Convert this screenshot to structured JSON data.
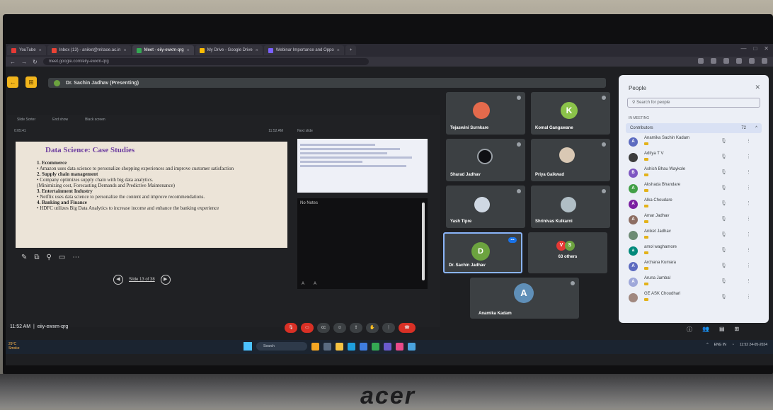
{
  "browser": {
    "tabs": [
      {
        "label": "YouTube",
        "color": "#e53935",
        "active": false
      },
      {
        "label": "Inbox (13) - aniket@mitaoe.ac.in",
        "color": "#ea4335",
        "active": false
      },
      {
        "label": "Meet - eiiy-ewxm-qrg",
        "color": "#34a853",
        "active": true
      },
      {
        "label": "My Drive - Google Drive",
        "color": "#fbbc04",
        "active": false
      },
      {
        "label": "Webinar Importance and Oppo",
        "color": "#7b61ff",
        "active": false
      }
    ],
    "url": "meet.google.com/eiiy-ewxm-qrg"
  },
  "meet": {
    "presenting_label": "Dr. Sachin Jadhav (Presenting)",
    "presentation": {
      "top_tabs": [
        "Slide Sorter",
        "End show",
        "Black screen"
      ],
      "timer_left": "0:05:41",
      "timer_right": "11:52 AM",
      "next_slide_label": "Next slide",
      "notes_label": "No Notes",
      "slide_counter": "Slide 13 of 38",
      "slide": {
        "title": "Data Science:  Case Studies",
        "lines": [
          {
            "text": "1. Ecommerce",
            "heading": true
          },
          {
            "text": "• Amazon uses data science to personalize shopping experiences and improve customer satisfaction",
            "heading": false
          },
          {
            "text": "2. Supply chain management",
            "heading": true
          },
          {
            "text": "• Company optimizes supply chain with big data analytics.",
            "heading": false
          },
          {
            "text": "  (Minimizing cost, Forecasting Demands and Predictive Maintenance)",
            "heading": false
          },
          {
            "text": "3. Entertainment Industry",
            "heading": true
          },
          {
            "text": "• Netflix uses data science to personalize the content and improve recommendations.",
            "heading": false
          },
          {
            "text": "4. Banking and Finance",
            "heading": true
          },
          {
            "text": "• HDFC utilizes Big Data Analytics to increase income and enhance the banking experience",
            "heading": false
          }
        ]
      }
    },
    "tiles": [
      {
        "name": "Tejaswini Surnkare",
        "initial": "",
        "avatar_color": "#e46a4c"
      },
      {
        "name": "Komal Gangawane",
        "initial": "K",
        "avatar_color": "#8bc34a"
      },
      {
        "name": "Sharad Jadhav",
        "initial": "",
        "avatar_color": "#2d3440"
      },
      {
        "name": "Priya Gaikwad",
        "initial": "",
        "avatar_color": "#d9c8b4"
      },
      {
        "name": "Yash Tipre",
        "initial": "",
        "avatar_color": "#cfd8e3"
      },
      {
        "name": "Shrinivas Kulkarni",
        "initial": "",
        "avatar_color": "#b0bec5"
      },
      {
        "name": "Dr. Sachin Jadhav",
        "initial": "D",
        "avatar_color": "#6ca33f"
      },
      {
        "name": "63 others",
        "initial": "",
        "avatar_color": "#e53935"
      },
      {
        "name": "Anamika Kadam",
        "initial": "A",
        "avatar_color": "#5f8fb8"
      }
    ],
    "clock": "11:52 AM",
    "meeting_code": "eiiy-ewxm-qrg"
  },
  "people_panel": {
    "title": "People",
    "search_placeholder": "Search for people",
    "in_meeting_label": "IN MEETING",
    "contributors_label": "Contributors",
    "contributors_count": "72",
    "people": [
      {
        "name": "Anamika Sachin Kadam",
        "initial": "A",
        "color": "#5c6bc0"
      },
      {
        "name": "Aditya T V",
        "initial": "",
        "color": "#3c3c3c"
      },
      {
        "name": "Ashish Bhau Waykole",
        "initial": "B",
        "color": "#7e57c2"
      },
      {
        "name": "Akshada Bhandare",
        "initial": "A",
        "color": "#43a047"
      },
      {
        "name": "Alka Choudare",
        "initial": "A",
        "color": "#7b1fa2"
      },
      {
        "name": "Amar Jadhav",
        "initial": "A",
        "color": "#8d6e63"
      },
      {
        "name": "Aniket Jadhav",
        "initial": "",
        "color": "#6d8b74"
      },
      {
        "name": "amol waghamore",
        "initial": "a",
        "color": "#00897b"
      },
      {
        "name": "Archana Kumara",
        "initial": "A",
        "color": "#5c6bc0"
      },
      {
        "name": "Aruna Jambal",
        "initial": "A",
        "color": "#9fa8da"
      },
      {
        "name": "GE ASK Choudhari",
        "initial": "",
        "color": "#a1887f"
      }
    ]
  },
  "taskbar": {
    "weather": "29°C Smoke",
    "search_label": "Search",
    "tray_lang": "ENG IN",
    "tray_time": "11:52",
    "tray_date": "24-05-2024"
  },
  "monitor": {
    "brand": "acer"
  }
}
